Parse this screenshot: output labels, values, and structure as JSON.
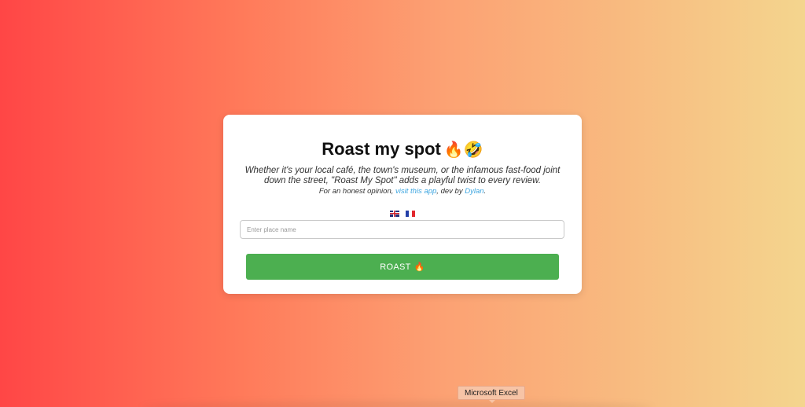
{
  "card": {
    "title": "Roast my spot",
    "title_emoji": "🔥🤣",
    "description": "Whether it's your local café, the town's museum, or the infamous fast-food joint down the street, \"Roast My Spot\" adds a playful twist to every review.",
    "byline": {
      "prefix": "For an honest opinion, ",
      "link1": "visit this app",
      "middle": ", dev by ",
      "link2": "Dylan",
      "suffix": "."
    },
    "languages": [
      {
        "code": "en",
        "icon": "uk-flag-icon"
      },
      {
        "code": "fr",
        "icon": "fr-flag-icon"
      }
    ],
    "search": {
      "placeholder": "Enter place name",
      "value": ""
    },
    "button": {
      "label": "ROAST",
      "emoji": "🔥"
    }
  },
  "dock": {
    "tooltip": "Microsoft Excel"
  },
  "colors": {
    "gradient_start": "#ff4646",
    "gradient_end": "#f4d58e",
    "button": "#4caf50",
    "link": "#3ea6e0"
  }
}
